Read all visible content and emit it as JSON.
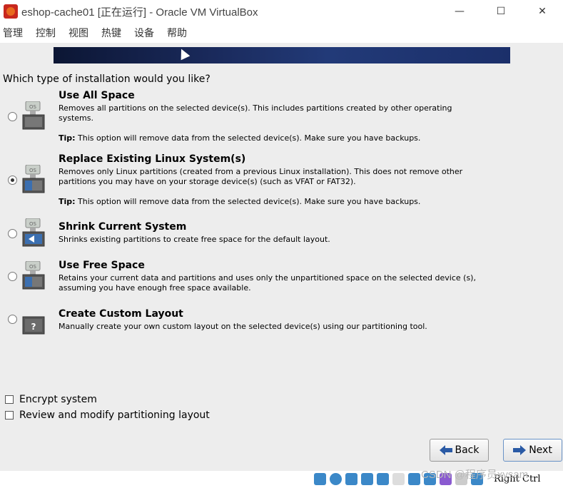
{
  "window": {
    "title": "eshop-cache01 [正在运行] - Oracle VM VirtualBox",
    "minimize_glyph": "—",
    "maximize_glyph": "☐",
    "close_glyph": "✕"
  },
  "menubar": {
    "items": [
      "管理",
      "控制",
      "视图",
      "热键",
      "设备",
      "帮助"
    ]
  },
  "installer": {
    "question": "Which type of installation would you like?",
    "options": [
      {
        "title": "Use All Space",
        "desc": "Removes all partitions on the selected device(s).  This includes partitions created by other operating systems.",
        "tip_label": "Tip:",
        "tip": " This option will remove data from the selected device(s).  Make sure you have backups.",
        "icon": "disk-os-full-icon",
        "selected": false
      },
      {
        "title": "Replace Existing Linux System(s)",
        "desc": "Removes only Linux partitions (created from a previous Linux installation).  This does not remove other partitions you may have on your storage device(s) (such as VFAT or FAT32).",
        "tip_label": "Tip:",
        "tip": " This option will remove data from the selected device(s).  Make sure you have backups.",
        "icon": "disk-os-linux-icon",
        "selected": true
      },
      {
        "title": "Shrink Current System",
        "desc": "Shrinks existing partitions to create free space for the default layout.",
        "icon": "disk-os-shrink-icon",
        "selected": false
      },
      {
        "title": "Use Free Space",
        "desc": "Retains your current data and partitions and uses only the unpartitioned space on the selected device (s), assuming you have enough free space available.",
        "icon": "disk-os-free-icon",
        "selected": false
      },
      {
        "title": "Create Custom Layout",
        "desc": "Manually create your own custom layout on the selected device(s) using our partitioning tool.",
        "icon": "disk-custom-icon",
        "selected": false
      }
    ],
    "encrypt_label": "Encrypt system",
    "review_label": "Review and modify partitioning layout",
    "back_label": "Back",
    "next_label": "Next"
  },
  "statusbar": {
    "host_key": "Right Ctrl"
  },
  "watermark": "CSDN @程序员xysam",
  "colors": {
    "banner_dark": "#0c1634",
    "banner_light": "#223a78",
    "accent": "#3b88c8"
  }
}
